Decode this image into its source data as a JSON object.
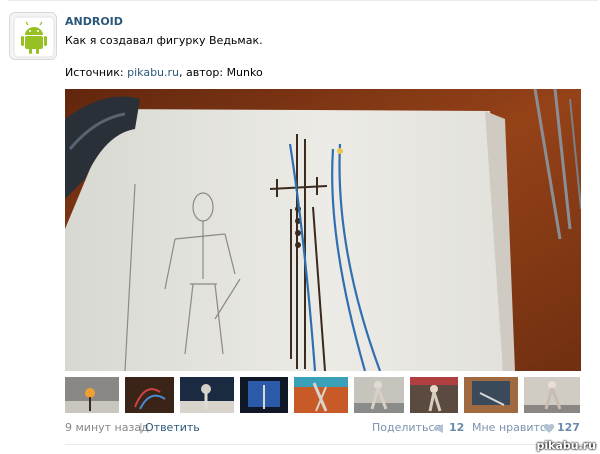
{
  "post": {
    "author": "ANDROID",
    "text": "Как я создавал фигурку Ведьмак.",
    "source_prefix": "Источник: ",
    "source_link": "pikabu.ru",
    "source_sep": ", автор: ",
    "source_author": "Munko"
  },
  "footer": {
    "time": "9 минут назад",
    "separator": "|",
    "reply": "Ответить",
    "share": "Поделиться",
    "share_count": "12",
    "like": "Мне нравится",
    "like_count": "127"
  },
  "icons": {
    "avatar": "android-robot-icon",
    "share": "megaphone-icon",
    "like": "heart-icon"
  },
  "colors": {
    "link": "#2b587a",
    "meta": "#888888",
    "android_green": "#97c024"
  },
  "watermark": "pikabu.ru"
}
